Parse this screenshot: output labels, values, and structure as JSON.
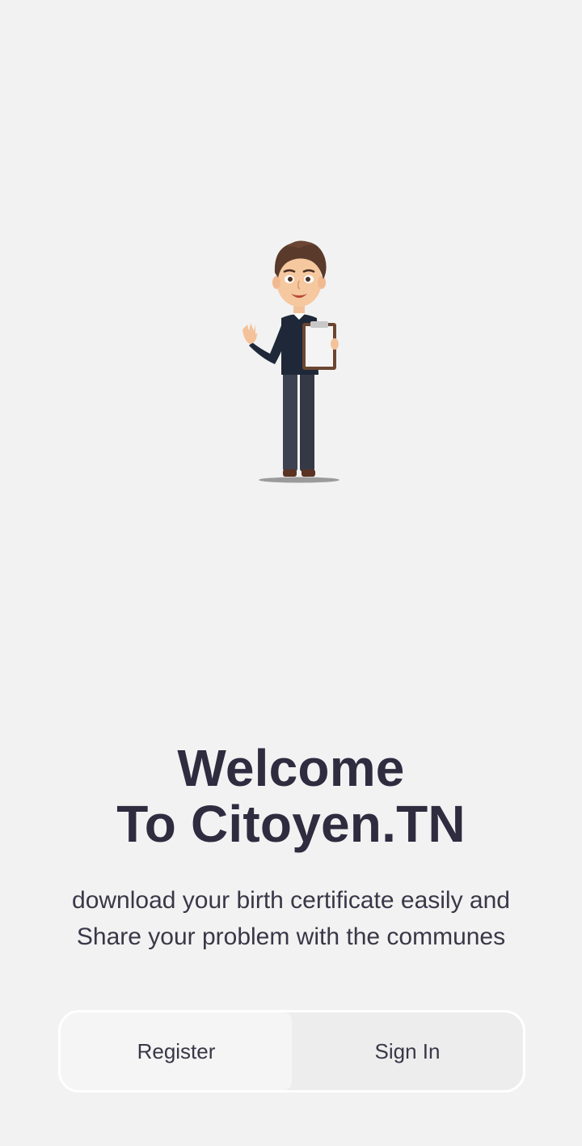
{
  "welcome": {
    "title_line1": "Welcome",
    "title_line2": "To Citoyen.TN",
    "subtitle_line1": "download your birth certificate easily and",
    "subtitle_line2": "Share your problem with the communes"
  },
  "auth_toggle": {
    "register_label": "Register",
    "signin_label": "Sign In",
    "selected": "Register"
  },
  "illustration": {
    "subject": "cartoon-man-waving-holding-clipboard"
  },
  "colors": {
    "background": "#f2f2f2",
    "text": "#2f2c40",
    "toggle_bg": "#ededed",
    "toggle_active": "#f4f5f4",
    "toggle_border": "#ffffff"
  }
}
